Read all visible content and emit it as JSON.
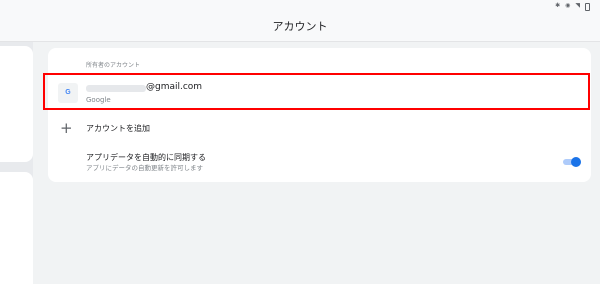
{
  "status_bar": {
    "icons": [
      "bluetooth-icon",
      "eye-icon",
      "wifi-icon",
      "battery-icon"
    ]
  },
  "app_bar": {
    "title": "アカウント"
  },
  "accounts_section": {
    "header": "所有者のアカウント",
    "account": {
      "icon_letter": "G",
      "email_suffix": "@gmail.com",
      "provider": "Google"
    },
    "add_account_label": "アカウントを追加",
    "sync": {
      "title": "アプリデータを自動的に同期する",
      "subtitle": "アプリにデータの自動更新を許可します",
      "enabled": true
    }
  },
  "colors": {
    "accent": "#1a73e8",
    "highlight": "#ff0000",
    "background": "#f1f3f4"
  }
}
